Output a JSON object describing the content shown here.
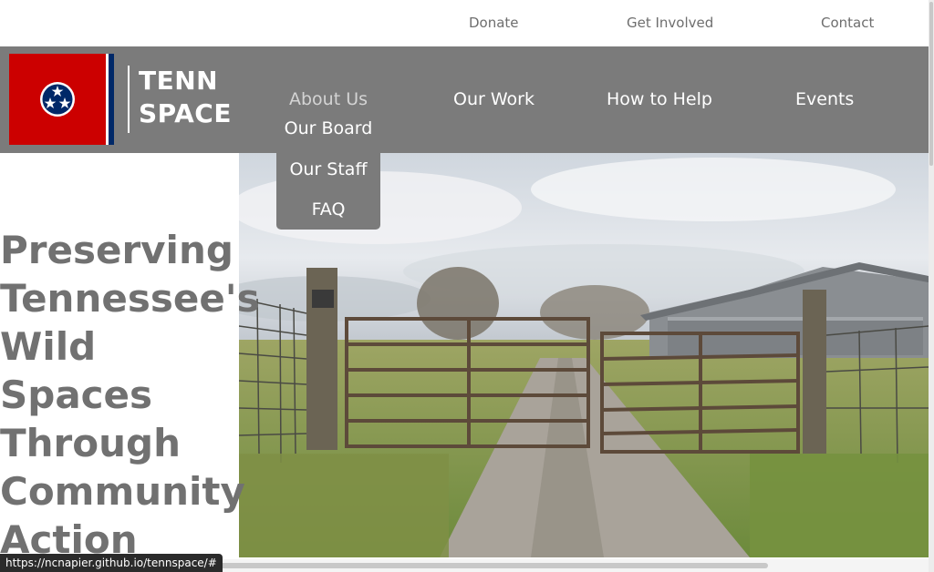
{
  "utility_nav": {
    "donate": "Donate",
    "get_involved": "Get Involved",
    "contact": "Contact"
  },
  "logo": {
    "line1": "TENN",
    "line2": "SPACE"
  },
  "main_nav": {
    "about_us": "About Us",
    "our_work": "Our Work",
    "how_to_help": "How to Help",
    "events": "Events"
  },
  "about_dropdown": {
    "our_board": "Our Board",
    "our_staff": "Our Staff",
    "faq": "FAQ"
  },
  "hero": {
    "headline_lines": [
      "Preserving",
      "Tennessee's",
      "Wild",
      "Spaces",
      "Through",
      "Community",
      "Action"
    ]
  },
  "status_bar": {
    "url": "https://ncnapier.github.io/tennspace/#"
  },
  "colors": {
    "nav_background": "#7b7b7b",
    "headline_text": "#717171",
    "flag_red": "#cc0000",
    "flag_blue": "#002868"
  },
  "icons": [
    "tennessee-flag-icon"
  ]
}
